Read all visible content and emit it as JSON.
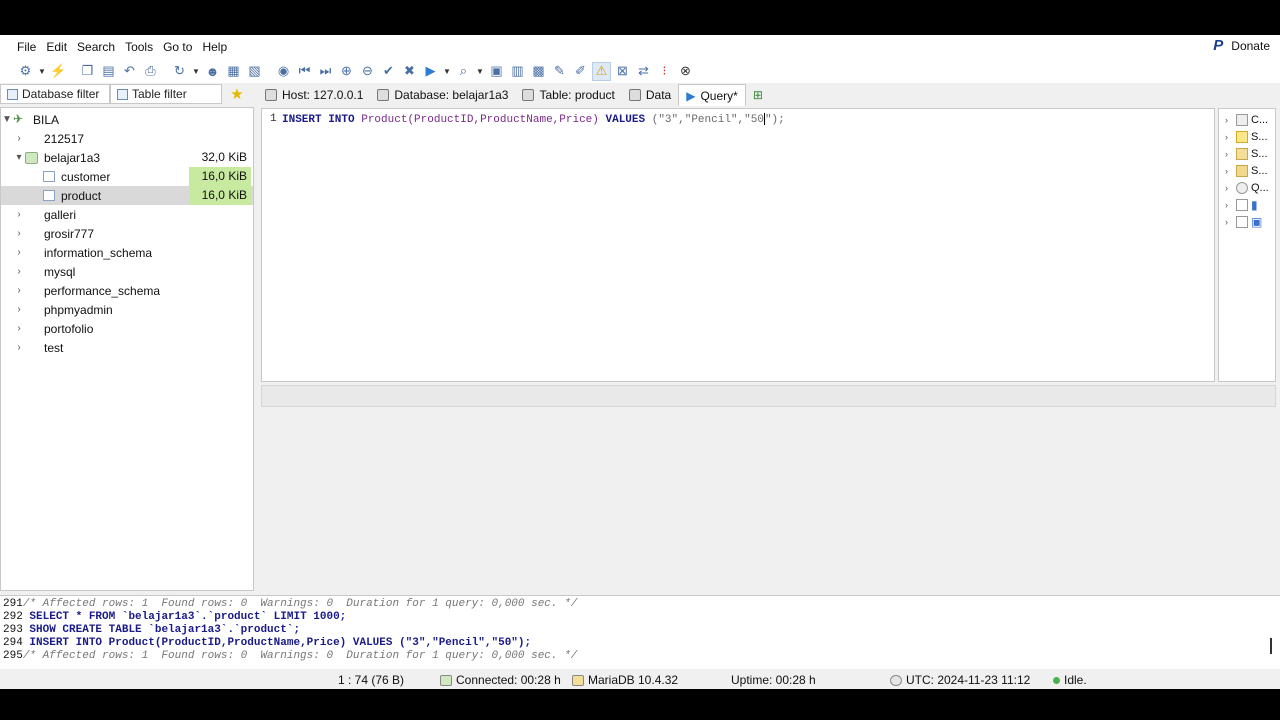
{
  "menu": [
    "File",
    "Edit",
    "Search",
    "Tools",
    "Go to",
    "Help"
  ],
  "donate_label": "Donate",
  "filters": {
    "database_filter": "Database filter",
    "table_filter": "Table filter"
  },
  "tabs": {
    "host": "Host: 127.0.0.1",
    "database": "Database: belajar1a3",
    "table": "Table: product",
    "data": "Data",
    "query": "Query*"
  },
  "tree": {
    "root": "BILA",
    "databases": [
      {
        "name": "212517"
      },
      {
        "name": "belajar1a3",
        "size": "32,0 KiB"
      },
      {
        "name": "galleri"
      },
      {
        "name": "grosir777"
      },
      {
        "name": "information_schema"
      },
      {
        "name": "mysql"
      },
      {
        "name": "performance_schema"
      },
      {
        "name": "phpmyadmin"
      },
      {
        "name": "portofolio"
      },
      {
        "name": "test"
      }
    ],
    "tables": [
      {
        "name": "customer",
        "size": "16,0 KiB"
      },
      {
        "name": "product",
        "size": "16,0 KiB"
      }
    ]
  },
  "editor": {
    "line_number": "1",
    "kw_insert": "INSERT INTO",
    "fn_table": "Product",
    "cols": "(ProductID,ProductName,Price)",
    "kw_values": "VALUES",
    "vals_open": "(\"3\",\"Pencil\",\"5",
    "vals_cursor_char": "0",
    "vals_close": "\");"
  },
  "helper_items": [
    "C...",
    "S...",
    "S...",
    "S...",
    "Q...",
    "",
    ""
  ],
  "log": [
    {
      "no": "291",
      "text": "/* Affected rows: 1  Found rows: 0  Warnings: 0  Duration for 1 query: 0,000 sec. */",
      "type": "comment"
    },
    {
      "no": "292",
      "text": "SELECT * FROM `belajar1a3`.`product` LIMIT 1000;",
      "type": "sql"
    },
    {
      "no": "293",
      "text": "SHOW CREATE TABLE `belajar1a3`.`product`;",
      "type": "sql"
    },
    {
      "no": "294",
      "text": "INSERT INTO Product(ProductID,ProductName,Price) VALUES (\"3\",\"Pencil\",\"50\");",
      "type": "sql"
    },
    {
      "no": "295",
      "text": "/* Affected rows: 1  Found rows: 0  Warnings: 0  Duration for 1 query: 0,000 sec. */",
      "type": "comment"
    }
  ],
  "status": {
    "position": "1 : 74 (76 B)",
    "connected": "Connected: 00:28 h",
    "server": "MariaDB 10.4.32",
    "uptime": "Uptime: 00:28 h",
    "utc": "UTC: 2024-11-23 11:12",
    "state": "Idle."
  }
}
